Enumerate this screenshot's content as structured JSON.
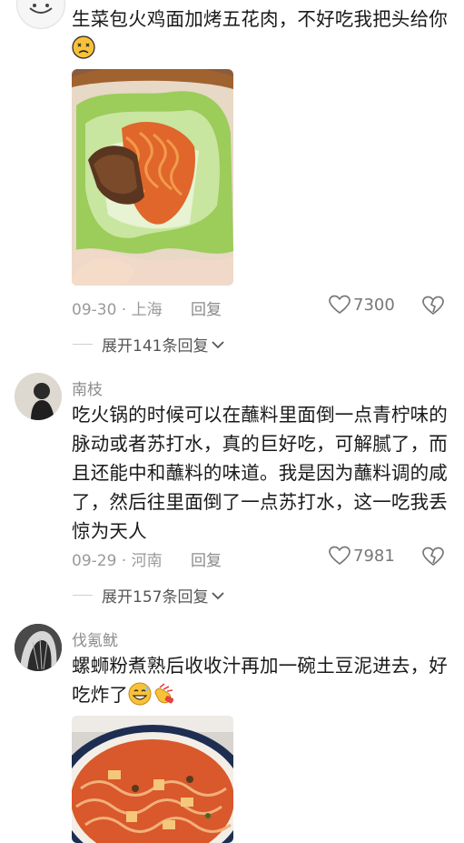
{
  "comments": [
    {
      "text": "生菜包火鸡面加烤五花肉，不好吃我把头给你",
      "date": "09-30 · 上海",
      "reply_label": "回复",
      "likes": "7300",
      "expand_label": "展开141条回复"
    },
    {
      "username": "南枝",
      "text": "吃火锅的时候可以在蘸料里面倒一点青柠味的脉动或者苏打水，真的巨好吃，可解腻了，而且还能中和蘸料的味道。我是因为蘸料调的咸了，然后往里面倒了一点苏打水，这一吃我丢惊为天人",
      "date": "09-29 · 河南",
      "reply_label": "回复",
      "likes": "7981",
      "expand_label": "展开157条回复"
    },
    {
      "username": "伐氪鱿",
      "text": "螺蛳粉煮熟后收收汁再加一碗土豆泥进去，好吃炸了"
    }
  ],
  "icons": {
    "like": "heart-outline-icon",
    "dislike": "broken-heart-icon",
    "expand": "chevron-down-icon"
  },
  "colors": {
    "meta_gray": "#9a9a9a",
    "text": "#1a1a1a"
  }
}
